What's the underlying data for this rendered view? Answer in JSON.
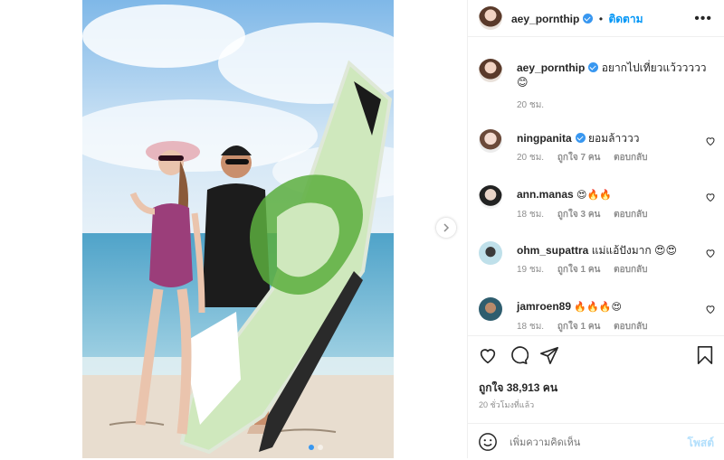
{
  "post": {
    "username": "aey_pornthip",
    "follow_label": "ติดตาม",
    "more_label": "•••",
    "caption": {
      "username": "aey_pornthip",
      "text": "อยากไปเที่ยวแว้ววววว 😊",
      "time": "20 ชม."
    },
    "comments": [
      {
        "username": "ningpanita",
        "verified": true,
        "text": "ยอมล้าววว",
        "time": "20 ชม.",
        "likes": "ถูกใจ 7 คน",
        "reply": "ตอบกลับ"
      },
      {
        "username": "ann.manas",
        "verified": false,
        "text": "😍🔥🔥",
        "time": "18 ชม.",
        "likes": "ถูกใจ 3 คน",
        "reply": "ตอบกลับ"
      },
      {
        "username": "ohm_supattra",
        "verified": false,
        "text": "แม่แอ้ปังมาก 😍😍",
        "time": "19 ชม.",
        "likes": "ถูกใจ 1 คน",
        "reply": "ตอบกลับ"
      },
      {
        "username": "jamroen89",
        "verified": false,
        "text": "🔥🔥🔥😍",
        "time": "18 ชม.",
        "likes": "ถูกใจ 1 คน",
        "reply": "ตอบกลับ"
      }
    ],
    "likes_text": "ถูกใจ 38,913 คน",
    "posted_time": "20 ชั่วโมงที่แล้ว",
    "comment_placeholder": "เพิ่มความคิดเห็น",
    "post_label": "โพสต์",
    "icons": [
      "heart-icon",
      "comment-icon",
      "share-icon",
      "bookmark-icon",
      "emoji-icon",
      "chevron-right-icon"
    ],
    "colors": {
      "accent": "#0095f6",
      "verified": "#3897f0",
      "muted": "#8e8e8e"
    }
  }
}
